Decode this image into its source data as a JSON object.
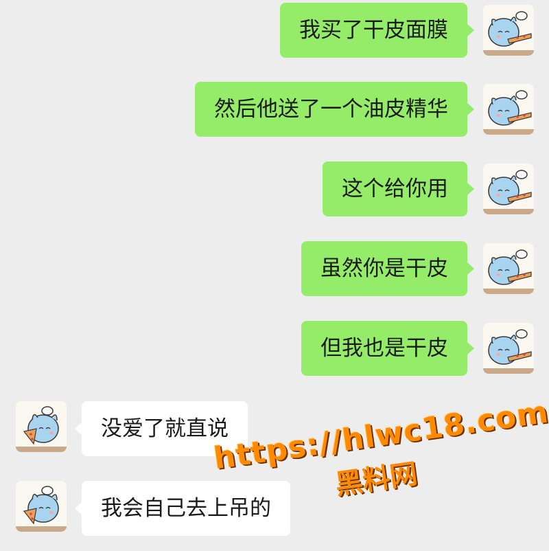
{
  "chat": {
    "messages": [
      {
        "sender": "me",
        "text": "我买了干皮面膜",
        "avatar": "chef-cat-avatar"
      },
      {
        "sender": "me",
        "text": "然后他送了一个油皮精华",
        "avatar": "chef-cat-avatar"
      },
      {
        "sender": "me",
        "text": "这个给你用",
        "avatar": "chef-cat-avatar"
      },
      {
        "sender": "me",
        "text": "虽然你是干皮",
        "avatar": "chef-cat-avatar"
      },
      {
        "sender": "me",
        "text": "但我也是干皮",
        "avatar": "chef-cat-avatar"
      },
      {
        "sender": "other",
        "text": "没爱了就直说",
        "avatar": "chef-cat-pizza-avatar"
      },
      {
        "sender": "other",
        "text": "我会自己去上吊的",
        "avatar": "chef-cat-pizza-avatar"
      }
    ]
  },
  "watermark": {
    "url": "https://hlwc18.com",
    "name": "黑料网"
  },
  "colors": {
    "background": "#ededed",
    "my_bubble": "#95ec69",
    "other_bubble": "#ffffff",
    "watermark": "#ff8a00"
  }
}
